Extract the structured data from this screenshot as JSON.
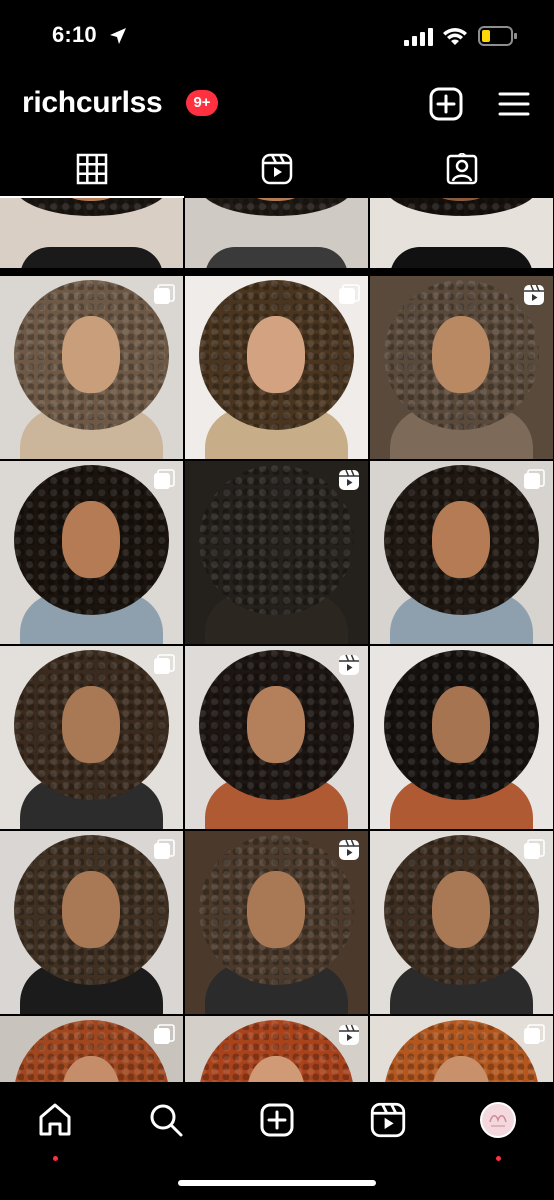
{
  "status_bar": {
    "time": "6:10"
  },
  "header": {
    "username": "richcurlss",
    "notification_badge": "9+"
  },
  "tabs": [
    {
      "name": "grid-icon",
      "active": true
    },
    {
      "name": "reels-icon",
      "active": false
    },
    {
      "name": "tagged-icon",
      "active": false
    }
  ],
  "posts": [
    {
      "type": "photo",
      "hair": "#1c1712",
      "bg": "#d9cfc4",
      "skin": "#b27a55",
      "shirt": "#1a1a1a",
      "overlay": "none"
    },
    {
      "type": "photo",
      "hair": "#1f1a14",
      "bg": "#cfcac3",
      "skin": "#b27a55",
      "shirt": "#3a3a3a",
      "overlay": "none"
    },
    {
      "type": "photo",
      "hair": "#17120e",
      "bg": "#e7e1dc",
      "skin": "#8a5b3d",
      "shirt": "#111111",
      "overlay": "none"
    },
    {
      "type": "photo",
      "hair": "#6d5946",
      "bg": "#dad6d1",
      "skin": "#c89f7a",
      "shirt": "#cbb59b",
      "overlay": "carousel"
    },
    {
      "type": "photo",
      "hair": "#4a3520",
      "bg": "#efece9",
      "skin": "#d3a281",
      "shirt": "#c7ad88",
      "overlay": "carousel"
    },
    {
      "type": "photo",
      "hair": "#5a4a3b",
      "bg": "#5a4a3b",
      "skin": "#b88963",
      "shirt": "#7d6a58",
      "overlay": "reel"
    },
    {
      "type": "photo",
      "hair": "#1a130e",
      "bg": "#dcd8d4",
      "skin": "#b47b55",
      "shirt": "#8ea0ad",
      "overlay": "carousel"
    },
    {
      "type": "photo",
      "hair": "#24201b",
      "bg": "#24201b",
      "skin": "#24201b",
      "shirt": "#2b2620",
      "overlay": "reel"
    },
    {
      "type": "photo",
      "hair": "#1f1711",
      "bg": "#d7d3cf",
      "skin": "#b47b55",
      "shirt": "#8ea0ad",
      "overlay": "carousel"
    },
    {
      "type": "photo",
      "hair": "#3b2b1e",
      "bg": "#e3e0dc",
      "skin": "#a97855",
      "shirt": "#2c2c2c",
      "overlay": "carousel"
    },
    {
      "type": "photo",
      "hair": "#1c1511",
      "bg": "#dedbd8",
      "skin": "#b47f5b",
      "shirt": "#b05a33",
      "overlay": "reel"
    },
    {
      "type": "photo",
      "hair": "#15110e",
      "bg": "#e8e5e2",
      "skin": "#a77452",
      "shirt": "#b05a33",
      "overlay": "none"
    },
    {
      "type": "photo",
      "hair": "#3f3022",
      "bg": "#d9d6d3",
      "skin": "#a97855",
      "shirt": "#1b1b1b",
      "overlay": "carousel"
    },
    {
      "type": "photo",
      "hair": "#4b3a2b",
      "bg": "#4b3a2b",
      "skin": "#a97855",
      "shirt": "#2b2b2b",
      "overlay": "reel"
    },
    {
      "type": "photo",
      "hair": "#3c2d20",
      "bg": "#e1deda",
      "skin": "#a97855",
      "shirt": "#2b2b2b",
      "overlay": "carousel"
    },
    {
      "type": "photo",
      "hair": "#a0471f",
      "bg": "#c9c3bd",
      "skin": "#c58d6a",
      "shirt": "#a0471f",
      "overlay": "carousel"
    },
    {
      "type": "photo",
      "hair": "#a9431c",
      "bg": "#d5cfc9",
      "skin": "#d09a76",
      "shirt": "#a9431c",
      "overlay": "reel"
    },
    {
      "type": "photo",
      "hair": "#b3571f",
      "bg": "#e4ded8",
      "skin": "#c8906b",
      "shirt": "#b3571f",
      "overlay": "carousel"
    }
  ],
  "bottom_nav": [
    {
      "name": "home-icon",
      "active": true
    },
    {
      "name": "search-icon",
      "active": false
    },
    {
      "name": "create-icon",
      "active": false
    },
    {
      "name": "reels-nav-icon",
      "active": false
    },
    {
      "name": "profile-avatar",
      "active": false
    }
  ],
  "colors": {
    "background": "#000000",
    "badge": "#ff3040",
    "text": "#ffffff"
  }
}
